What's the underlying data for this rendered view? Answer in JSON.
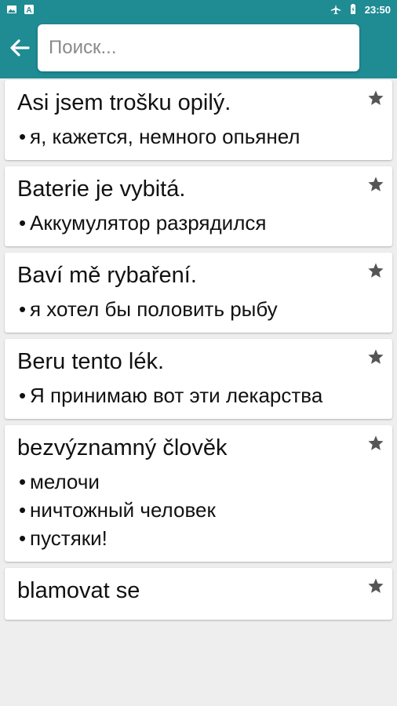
{
  "status_bar": {
    "time": "23:50",
    "left_icons": [
      "image-icon",
      "text-a-icon"
    ],
    "right_icons": [
      "airplane-icon",
      "battery-icon"
    ]
  },
  "app_bar": {
    "back_icon": "back-arrow-icon",
    "search": {
      "placeholder": "Поиск...",
      "value": ""
    }
  },
  "colors": {
    "accent": "#1f8b93",
    "background": "#eeeeee",
    "card": "#ffffff",
    "star": "#555555"
  },
  "entries": [
    {
      "term": "Asi jsem trošku opilý.",
      "translations": [
        "я, кажется, немного опьянел"
      ],
      "star_icon": "star-icon"
    },
    {
      "term": "Baterie je vybitá.",
      "translations": [
        "Аккумулятор разрядился"
      ],
      "star_icon": "star-icon"
    },
    {
      "term": "Baví mě rybaření.",
      "translations": [
        "я хотел бы половить рыбу"
      ],
      "star_icon": "star-icon"
    },
    {
      "term": "Beru tento lék.",
      "translations": [
        "Я принимаю вот эти лекарства"
      ],
      "star_icon": "star-icon"
    },
    {
      "term": "bezvýznamný člověk",
      "translations": [
        "мелочи",
        "ничтожный человек",
        "пустяки!"
      ],
      "star_icon": "star-icon"
    },
    {
      "term": "blamovat se",
      "translations": [],
      "star_icon": "star-icon"
    }
  ]
}
